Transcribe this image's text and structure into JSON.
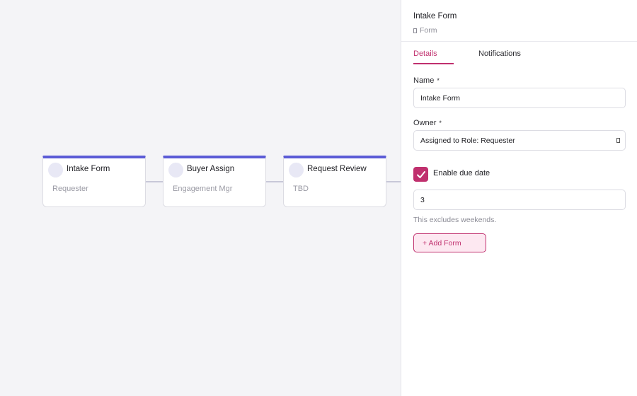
{
  "workflow": {
    "nodes": [
      {
        "title": "Intake Form",
        "subtitle": "Requester"
      },
      {
        "title": "Buyer Assign",
        "subtitle": "Engagement Mgr"
      },
      {
        "title": "Request Review",
        "subtitle": "TBD"
      }
    ]
  },
  "panel": {
    "title": "Intake Form",
    "type_label": "Form",
    "type_icon": "form-icon",
    "tabs": [
      {
        "label": "Details",
        "active": true
      },
      {
        "label": "Notifications",
        "active": false
      }
    ],
    "name_field": {
      "label": "Name",
      "required_marker": "*",
      "value": "Intake Form"
    },
    "owner_field": {
      "label": "Owner",
      "required_marker": "*",
      "value": "Assigned to Role: Requester"
    },
    "due_date": {
      "label": "Enable due date",
      "checked": true,
      "value": "3",
      "hint": "This excludes weekends."
    },
    "add_form_label": "+ Add Form"
  },
  "colors": {
    "accent": "#c0306e",
    "node_bar": "#5b5bd6",
    "accent_bg": "#fde8f1"
  }
}
